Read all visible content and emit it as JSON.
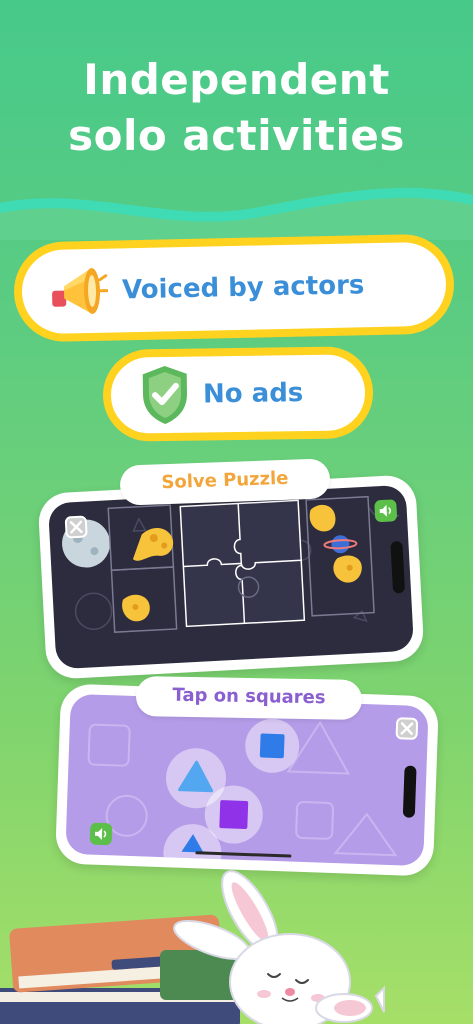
{
  "hero": {
    "title_line1": "Independent",
    "title_line2": "solo activities"
  },
  "features": [
    {
      "label": "Voiced by actors",
      "icon": "megaphone-icon"
    },
    {
      "label": "No ads",
      "icon": "shield-check-icon"
    }
  ],
  "activities": [
    {
      "caption": "Solve Puzzle",
      "theme": "space"
    },
    {
      "caption": "Tap on squares",
      "theme": "shapes"
    }
  ],
  "colors": {
    "background_top": "#47c98a",
    "background_bottom": "#a6df68",
    "pill_border": "#ffd21f",
    "pill_text": "#3a8fd8",
    "puzzle_caption": "#f2a53a",
    "squares_caption": "#8a5fd0"
  }
}
